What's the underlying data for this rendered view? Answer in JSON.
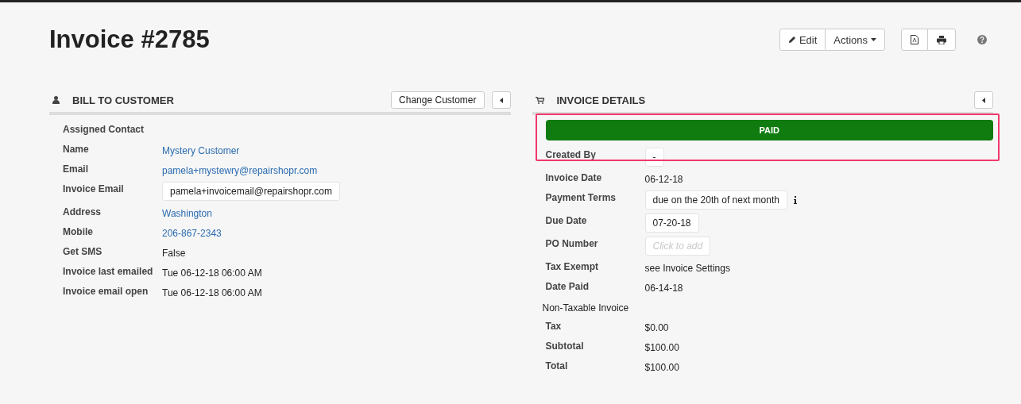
{
  "page_title": "Invoice #2785",
  "toolbar": {
    "buttons": [
      {
        "label": "Edit",
        "kind": "edit"
      },
      {
        "label": "Actions",
        "kind": "dropdown"
      }
    ],
    "icon_buttons": [
      {
        "kind": "pdf"
      },
      {
        "kind": "print"
      }
    ]
  },
  "bill_to": {
    "title": "BILL TO CUSTOMER",
    "button": "Change Customer",
    "rows": [
      {
        "label": "Assigned Contact",
        "kind": "label"
      },
      {
        "label": "Name",
        "kind": "link",
        "value": "Mystery Customer"
      },
      {
        "label": "Email",
        "kind": "link",
        "value": "pamela+mystewry@repairshopr.com"
      },
      {
        "label": "Invoice Email",
        "kind": "field",
        "value": "pamela+invoicemail@repairshopr.com"
      },
      {
        "label": "Address",
        "kind": "link",
        "value": "Washington"
      },
      {
        "label": "Mobile",
        "kind": "link",
        "value": "206-867-2343"
      },
      {
        "label": "Get SMS",
        "kind": "text",
        "value": "False"
      },
      {
        "label": "Invoice last emailed",
        "kind": "text",
        "value": "Tue 06-12-18 06:00 AM"
      },
      {
        "label": "Invoice email open",
        "kind": "text",
        "value": "Tue 06-12-18 06:00 AM"
      }
    ]
  },
  "invoice_details": {
    "title": "INVOICE DETAILS",
    "status": "PAID",
    "rows": [
      {
        "label": "Created By",
        "kind": "field",
        "value": "-"
      },
      {
        "label": "Invoice Date",
        "kind": "text",
        "value": "06-12-18"
      },
      {
        "label": "Payment Terms",
        "kind": "field",
        "value": "due on the 20th of next month",
        "info": true
      },
      {
        "label": "Due Date",
        "kind": "field",
        "value": "07-20-18"
      },
      {
        "label": "PO Number",
        "kind": "empty-field",
        "placeholder": "Click to add"
      },
      {
        "label": "Tax Exempt",
        "kind": "text",
        "value": "see Invoice Settings"
      },
      {
        "label": "Date Paid",
        "kind": "text",
        "value": "06-14-18"
      },
      {
        "label": "Non-Taxable Invoice",
        "kind": "note"
      },
      {
        "label": "Tax",
        "kind": "text",
        "value": "$0.00"
      },
      {
        "label": "Subtotal",
        "kind": "text",
        "value": "$100.00"
      },
      {
        "label": "Total",
        "kind": "text",
        "value": "$100.00"
      }
    ]
  }
}
